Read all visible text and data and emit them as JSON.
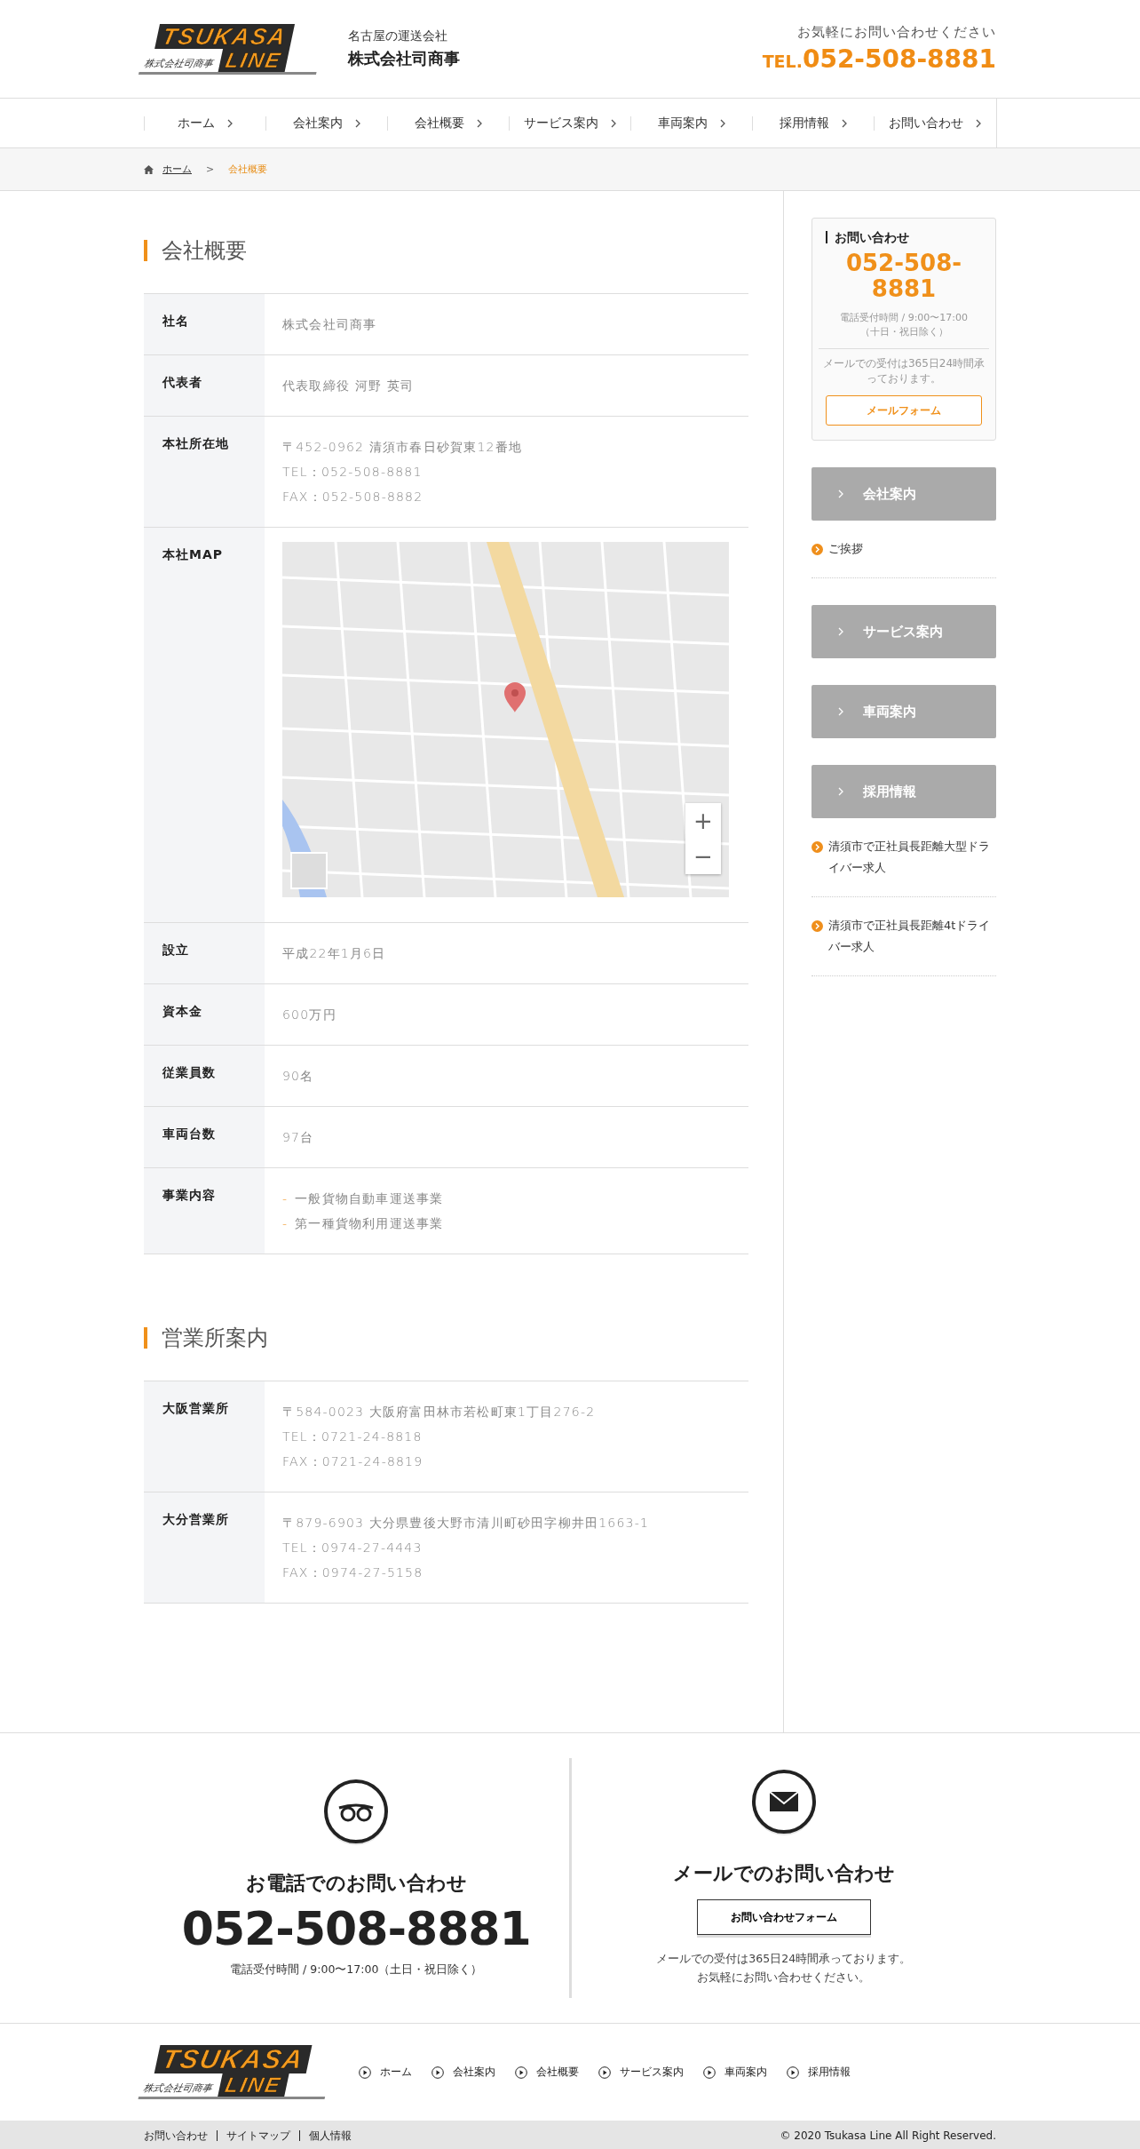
{
  "header": {
    "logo": {
      "top": "TSUKASA",
      "bottom": "LINE",
      "caption": "株式会社司商事"
    },
    "tagline": "名古屋の運送会社",
    "company": "株式会社司商事",
    "contact_prompt": "お気軽にお問い合わせください",
    "tel_prefix": "TEL.",
    "tel": "052-508-8881"
  },
  "nav": [
    "ホーム",
    "会社案内",
    "会社概要",
    "サービス案内",
    "車両案内",
    "採用情報",
    "お問い合わせ"
  ],
  "breadcrumb": {
    "items": [
      {
        "label": "ホーム",
        "kind": "link"
      },
      {
        "label": "会社概要",
        "kind": "current"
      }
    ],
    "separator": ">"
  },
  "sections": [
    {
      "title": "会社概要",
      "rows": [
        {
          "label": "社名",
          "kind": "text",
          "lines": [
            "株式会社司商事"
          ]
        },
        {
          "label": "代表者",
          "kind": "text",
          "lines": [
            "代表取締役 河野 英司"
          ]
        },
        {
          "label": "本社所在地",
          "kind": "text",
          "lines": [
            "〒452-0962 清須市春日砂賀東12番地",
            "TEL：052-508-8881",
            "FAX：052-508-8882"
          ]
        },
        {
          "label": "本社MAP",
          "kind": "map",
          "zoom_in": "+",
          "zoom_out": "−"
        },
        {
          "label": "設立",
          "kind": "text",
          "lines": [
            "平成22年1月6日"
          ]
        },
        {
          "label": "資本金",
          "kind": "text",
          "lines": [
            "600万円"
          ]
        },
        {
          "label": "従業員数",
          "kind": "text",
          "lines": [
            "90名"
          ]
        },
        {
          "label": "車両台数",
          "kind": "text",
          "lines": [
            "97台"
          ]
        },
        {
          "label": "事業内容",
          "kind": "list",
          "bullet": "-",
          "lines": [
            "一般貨物自動車運送事業",
            "第一種貨物利用運送事業"
          ]
        }
      ]
    },
    {
      "title": "営業所案内",
      "rows": [
        {
          "label": "大阪営業所",
          "kind": "text",
          "lines": [
            "〒584-0023 大阪府富田林市若松町東1丁目276-2",
            "TEL：0721-24-8818",
            "FAX：0721-24-8819"
          ]
        },
        {
          "label": "大分営業所",
          "kind": "text",
          "lines": [
            "〒879-6903 大分県豊後大野市清川町砂田字柳井田1663-1",
            "TEL：0974-27-4443",
            "FAX：0974-27-5158"
          ]
        }
      ]
    }
  ],
  "sidebar": {
    "contact": {
      "title": "お問い合わせ",
      "phone": "052-508-8881",
      "hours": [
        "電話受付時間 / 9:00〜17:00",
        "（十日・祝日除く）"
      ],
      "mail_note": "メールでの受付は365日24時間承っております。",
      "button": "メールフォーム"
    },
    "groups": [
      {
        "title": "会社案内",
        "links": [
          "ご挨拶"
        ]
      },
      {
        "title": "サービス案内"
      },
      {
        "title": "車両案内"
      },
      {
        "title": "採用情報",
        "links": [
          "清須市で正社員長距離大型ドライバー求人",
          "清須市で正社員長距離4tドライバー求人"
        ]
      }
    ]
  },
  "contact_band": {
    "phone": {
      "title": "お電話でのお問い合わせ",
      "number": "052-508-8881",
      "hours": "電話受付時間 / 9:00〜17:00（土日・祝日除く）"
    },
    "mail": {
      "title": "メールでのお問い合わせ",
      "button": "お問い合わせフォーム",
      "notes": [
        "メールでの受付は365日24時間承っております。",
        "お気軽にお問い合わせください。"
      ]
    }
  },
  "footer": {
    "logo": {
      "top": "TSUKASA",
      "bottom": "LINE",
      "caption": "株式会社司商事"
    },
    "links": [
      "ホーム",
      "会社案内",
      "会社概要",
      "サービス案内",
      "車両案内",
      "採用情報"
    ],
    "bottom_links": [
      "お問い合わせ",
      "サイトマップ",
      "個人情報"
    ],
    "copyright": "© 2020 Tsukasa Line All Right Reserved."
  }
}
